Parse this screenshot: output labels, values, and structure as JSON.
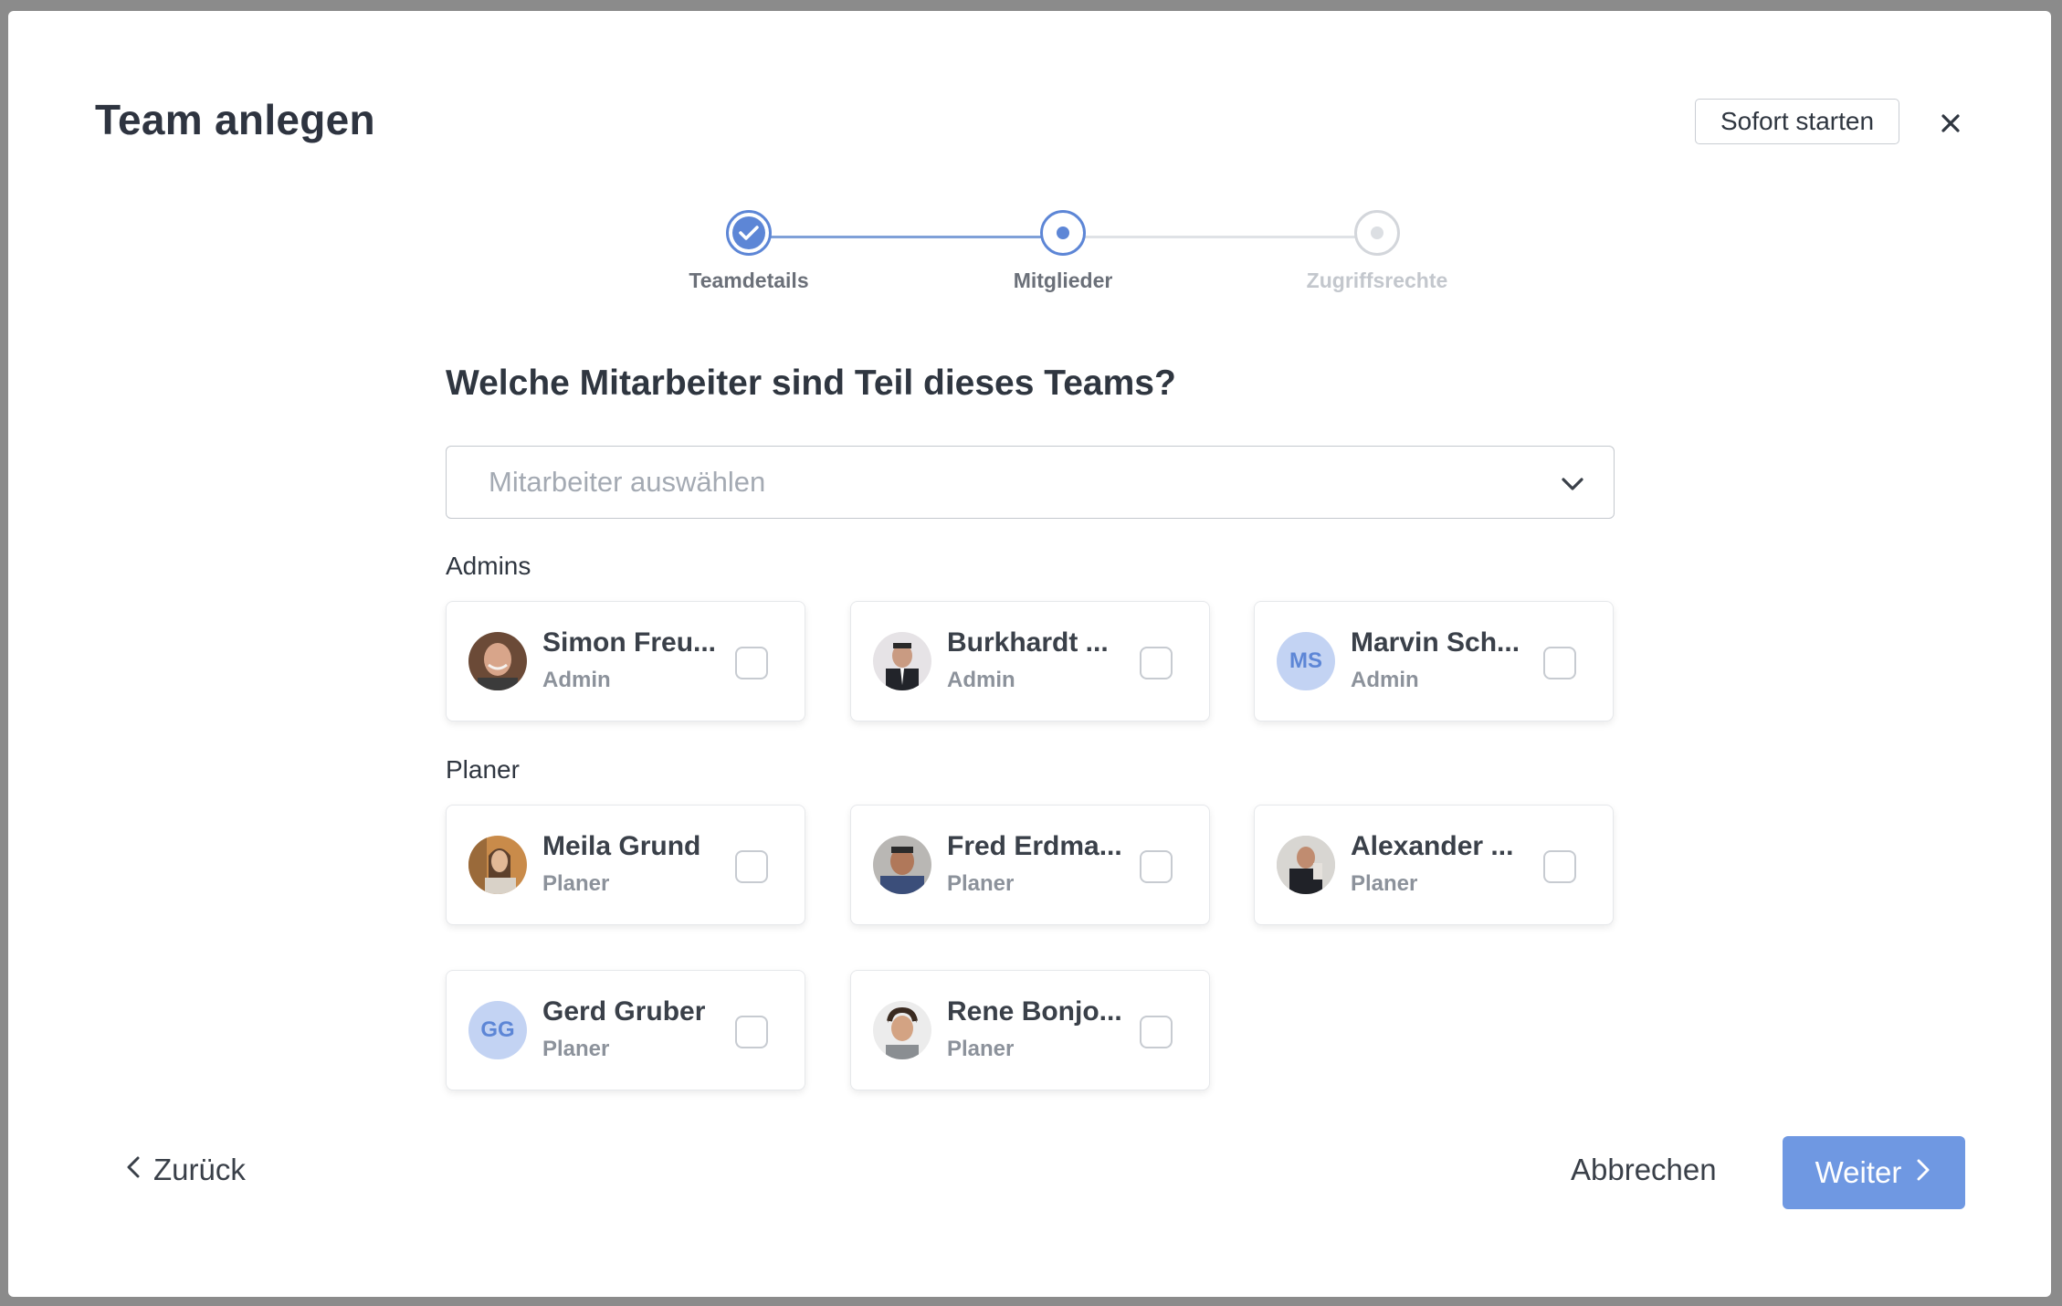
{
  "modal": {
    "title": "Team anlegen",
    "start_label": "Sofort starten",
    "close_icon": "close-icon"
  },
  "stepper": {
    "steps": [
      {
        "label": "Teamdetails",
        "state": "completed"
      },
      {
        "label": "Mitglieder",
        "state": "active"
      },
      {
        "label": "Zugriffsrechte",
        "state": "pending"
      }
    ],
    "colors": {
      "active": "#5d86d6",
      "pending": "#d3d6db",
      "pending_text": "#c3c7cd",
      "done_text": "#6b7079"
    }
  },
  "question": "Welche Mitarbeiter sind Teil dieses Teams?",
  "select": {
    "placeholder": "Mitarbeiter auswählen"
  },
  "groups": {
    "admins_label": "Admins",
    "planer_label": "Planer"
  },
  "members": [
    {
      "name": "Simon Freu...",
      "role": "Admin",
      "avatar": "photo",
      "checked": false
    },
    {
      "name": "Burkhardt ...",
      "role": "Admin",
      "avatar": "photo",
      "checked": false
    },
    {
      "name": "Marvin Sch...",
      "role": "Admin",
      "avatar": "MS",
      "checked": false
    },
    {
      "name": "Meila Grund",
      "role": "Planer",
      "avatar": "photo",
      "checked": false
    },
    {
      "name": "Fred Erdma...",
      "role": "Planer",
      "avatar": "photo",
      "checked": false
    },
    {
      "name": "Alexander ...",
      "role": "Planer",
      "avatar": "photo",
      "checked": false
    },
    {
      "name": "Gerd Gruber",
      "role": "Planer",
      "avatar": "GG",
      "checked": false
    },
    {
      "name": "Rene Bonjo...",
      "role": "Planer",
      "avatar": "photo",
      "checked": false
    }
  ],
  "footer": {
    "back_label": "Zurück",
    "cancel_label": "Abbrechen",
    "next_label": "Weiter"
  },
  "accent_color": "#6f98e2"
}
